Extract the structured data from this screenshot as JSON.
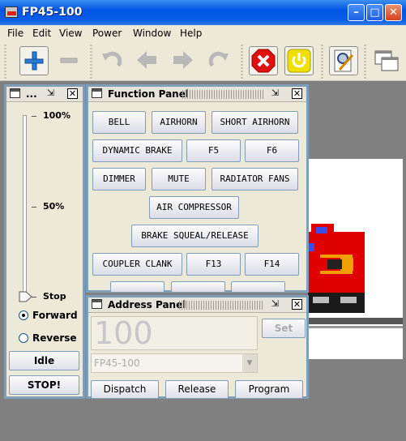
{
  "window": {
    "title": "FP45-100"
  },
  "menubar": [
    "File",
    "Edit",
    "View",
    "Power",
    "Window",
    "Help"
  ],
  "throttle": {
    "title": "...",
    "ticks": [
      "100%",
      "50%",
      "Stop"
    ],
    "speed_fraction": 0,
    "direction": {
      "forward": "Forward",
      "reverse": "Reverse",
      "selected": "forward"
    },
    "idle_label": "Idle",
    "stop_label": "STOP!"
  },
  "function_panel": {
    "title": "Function Panel",
    "buttons": [
      "BELL",
      "AIRHORN",
      "SHORT AIRHORN",
      "DYNAMIC BRAKE",
      "F5",
      "F6",
      "DIMMER",
      "MUTE",
      "RADIATOR FANS",
      "AIR COMPRESSOR",
      "BRAKE SQUEAL/RELEASE",
      "COUPLER CLANK",
      "F13",
      "F14"
    ]
  },
  "address_panel": {
    "title": "Address Panel",
    "address_value": "100",
    "set_label": "Set",
    "roster_selected": "FP45-100",
    "dispatch_label": "Dispatch",
    "release_label": "Release",
    "program_label": "Program"
  },
  "colors": {
    "titlebar": "#0054e3",
    "locomotive_red": "#e00000",
    "power_yellow": "#f0e000",
    "stop_red": "#e01010"
  }
}
